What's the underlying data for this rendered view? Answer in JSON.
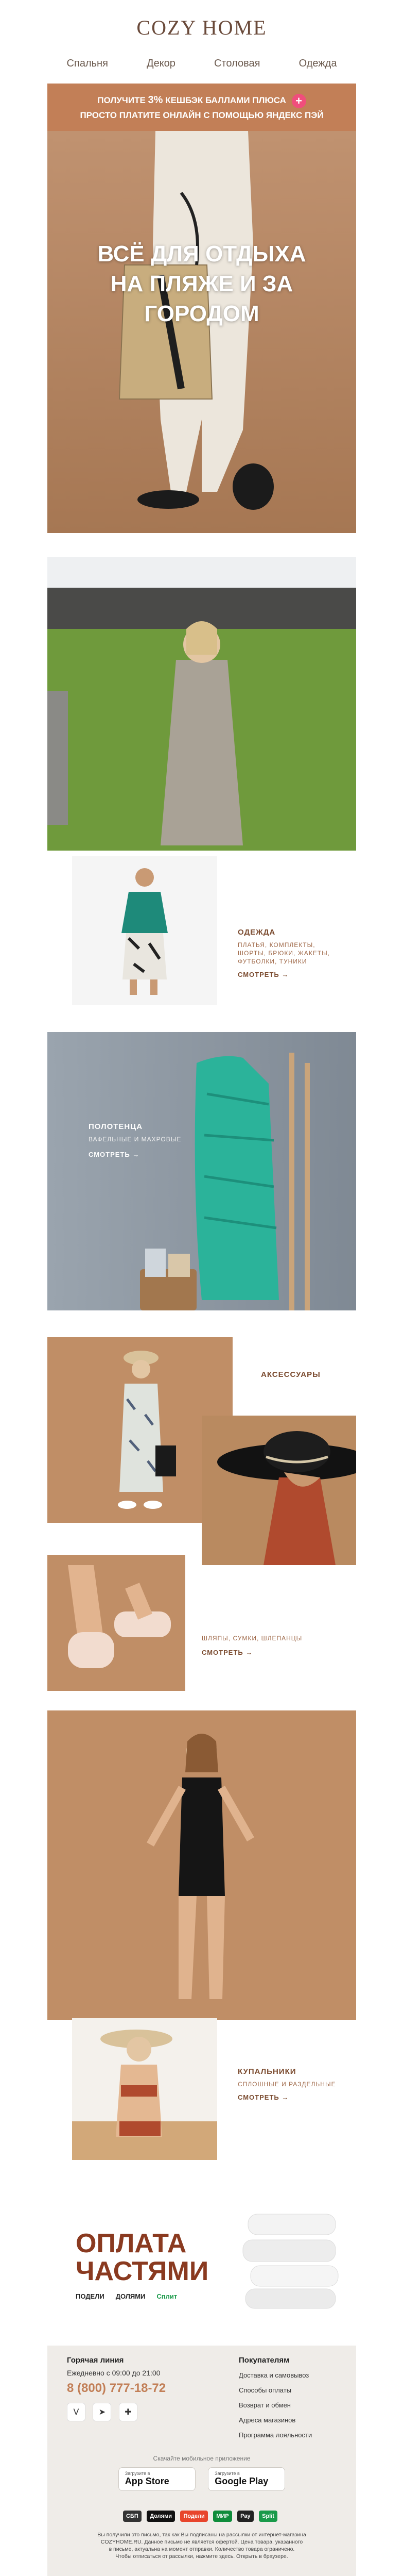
{
  "brand": {
    "logo_text": "COZY HOME"
  },
  "nav": [
    {
      "label": "Спальня"
    },
    {
      "label": "Декор"
    },
    {
      "label": "Столовая"
    },
    {
      "label": "Одежда"
    }
  ],
  "promo": {
    "line1_prefix": "ПОЛУЧИТЕ",
    "line1_percent": "3%",
    "line1_suffix": "КЕШБЭК БАЛЛАМИ ПЛЮСА",
    "line2": "ПРОСТО ПЛАТИТЕ ОНЛАЙН С ПОМОЩЬЮ ЯНДЕКС ПЭЙ",
    "plus_icon": "+"
  },
  "hero": {
    "title": "ВСЁ ДЛЯ ОТДЫХА НА ПЛЯЖЕ И ЗА ГОРОДОМ"
  },
  "sections": {
    "clothes": {
      "title": "ОДЕЖДА",
      "subtitle": "ПЛАТЬЯ, КОМПЛЕКТЫ, ШОРТЫ, БРЮКИ, ЖАКЕТЫ, ФУТБОЛКИ, ТУНИКИ",
      "more": "СМОТРЕТЬ →"
    },
    "towels": {
      "title": "ПОЛОТЕНЦА",
      "subtitle": "ВАФЕЛЬНЫЕ И МАХРОВЫЕ",
      "more": "СМОТРЕТЬ →"
    },
    "accessories": {
      "title": "АКСЕССУАРЫ",
      "subtitle": "ШЛЯПЫ, СУМКИ, ШЛЕПАНЦЫ",
      "more": "СМОТРЕТЬ →"
    },
    "swimwear": {
      "title": "КУПАЛЬНИКИ",
      "subtitle": "СПЛОШНЫЕ И РАЗДЕЛЬНЫЕ",
      "more": "СМОТРЕТЬ →"
    }
  },
  "installments": {
    "title_line1": "ОПЛАТА",
    "title_line2": "ЧАСТЯМИ",
    "providers": [
      "ПОДЕЛИ",
      "ДОЛЯМИ",
      "Сплит"
    ]
  },
  "footer": {
    "hotline_title": "Горячая линия",
    "hours": "Ежедневно с 09:00 до 21:00",
    "phone": "8 (800) 777-18-72",
    "customers_title": "Покупателям",
    "links": [
      "Доставка и самовывоз",
      "Способы оплаты",
      "Возврат и обмен",
      "Адреса магазинов",
      "Программа лояльности"
    ],
    "app_caption": "Скачайте мобильное приложение",
    "appstore": {
      "small": "Загрузите в",
      "big": "App Store"
    },
    "googleplay": {
      "small": "Загрузите в",
      "big": "Google Play"
    },
    "payments": [
      "СБП",
      "Долями",
      "Подели",
      "МИР",
      "Pay",
      "Split"
    ],
    "disclaimer1": "Вы получили это письмо, так как Вы подписаны на рассылки от интернет-магазина",
    "disclaimer2": "COZYHOME.RU. Данное письмо не является офертой. Цена товара, указанного",
    "disclaimer3": "в письме, актуальна на момент отправки. Количество товара ограничено.",
    "disclaimer4": "Чтобы отписаться от рассылки, нажмите здесь. Открыть в браузере."
  },
  "colors": {
    "accent": "#c27f57",
    "brown": "#7a4a2e",
    "phone": "#c27f57",
    "footer_bg": "#efece8"
  }
}
